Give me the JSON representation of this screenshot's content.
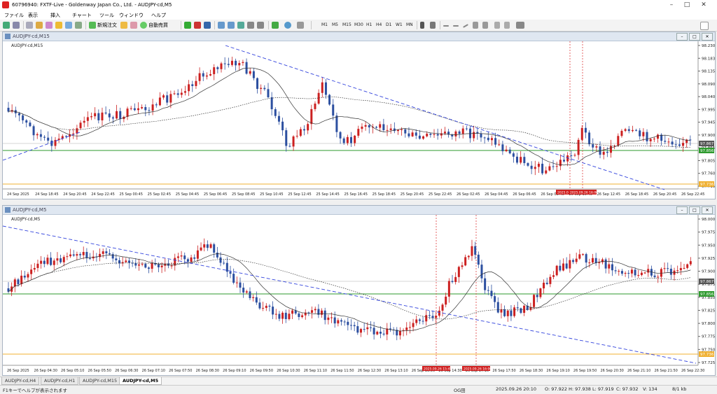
{
  "app": {
    "title": "60796940: FXTF-Live - Goldenway Japan Co., Ltd. - AUDJPY-cd,M5"
  },
  "menu": [
    "ファイル",
    "表示",
    "挿入",
    "チャート",
    "ツール",
    "ウィンドウ",
    "ヘルプ"
  ],
  "toolbar": {
    "new_order": "新規注文",
    "auto_trade": "自動売買",
    "timeframes": [
      "M1",
      "M5",
      "M15",
      "M30",
      "H1",
      "H4",
      "D1",
      "W1",
      "MN"
    ]
  },
  "colors": {
    "bull": "#cc2020",
    "bear": "#2c4fa0",
    "support": "#2e9a2e",
    "low_line": "#f0b030",
    "trend": "#3344dd",
    "vline": "#e04040"
  },
  "chart1": {
    "window_title": "AUDJPY-cd,M15",
    "label": "AUDJPY-cd,M15",
    "price_labels": [
      "98.230",
      "98.183",
      "98.135",
      "98.090",
      "98.040",
      "97.995",
      "97.945",
      "97.900",
      "97.855",
      "97.805",
      "97.760",
      "97.715"
    ],
    "current_price": "97.867",
    "green_price": "97.856",
    "yellow_price": "97.736",
    "time_labels": [
      "24 Sep 2025",
      "24 Sep 18:45",
      "24 Sep 20:45",
      "24 Sep 22:45",
      "25 Sep 00:45",
      "25 Sep 02:45",
      "25 Sep 04:45",
      "25 Sep 06:45",
      "25 Sep 08:45",
      "25 Sep 10:45",
      "25 Sep 12:45",
      "25 Sep 14:45",
      "25 Sep 16:45",
      "25 Sep 18:45",
      "25 Sep 20:45",
      "25 Sep 22:45",
      "26 Sep 02:45",
      "26 Sep 04:45",
      "26 Sep 06:45",
      "26 Sep 08:45",
      "26 Sep 10:45",
      "26 Sep 12:45",
      "26 Sep 18:45",
      "26 Sep 20:45",
      "26 Sep 22:45"
    ],
    "vline_labels": [
      "2025.09.26 ...",
      "2025.09.26 16:00"
    ]
  },
  "chart2": {
    "window_title": "AUDJPY-cd,M5",
    "label": "AUDJPY-cd,M5",
    "price_labels": [
      "98.000",
      "97.975",
      "97.950",
      "97.925",
      "97.900",
      "97.875",
      "97.850",
      "97.825",
      "97.800",
      "97.775",
      "97.750",
      "97.725"
    ],
    "current_price": "97.867",
    "green_price": "97.856",
    "yellow_price": "97.736",
    "time_labels": [
      "26 Sep 2025",
      "26 Sep 04:30",
      "26 Sep 05:10",
      "26 Sep 05:50",
      "26 Sep 06:30",
      "26 Sep 07:10",
      "26 Sep 07:50",
      "26 Sep 08:30",
      "26 Sep 09:10",
      "26 Sep 09:50",
      "26 Sep 10:30",
      "26 Sep 11:10",
      "26 Sep 11:50",
      "26 Sep 12:30",
      "26 Sep 13:10",
      "26 Sep 13:50",
      "26 Sep 14:30",
      "26 Sep 17:10",
      "26 Sep 17:50",
      "26 Sep 18:30",
      "26 Sep 19:10",
      "26 Sep 19:50",
      "26 Sep 20:30",
      "26 Sep 21:10",
      "26 Sep 21:50",
      "26 Sep 22:30"
    ],
    "vline_labels": [
      "2025.09.26 15:45",
      "2025.09.26 16:00"
    ]
  },
  "tabs": [
    "AUDJPY-cd,H4",
    "AUDJPY-cd,H1",
    "AUDJPY-cd,M15",
    "AUDJPY-cd,M5"
  ],
  "status": {
    "help": "F1キーでヘルプが表示されます",
    "profile": "OG田",
    "datetime": "2025.09.26 20:10",
    "open": "O: 97.922",
    "high": "H: 97.938",
    "low": "L: 97.919",
    "close": "C: 97.932",
    "volume": "V: 134",
    "traffic": "8/1 kb"
  }
}
